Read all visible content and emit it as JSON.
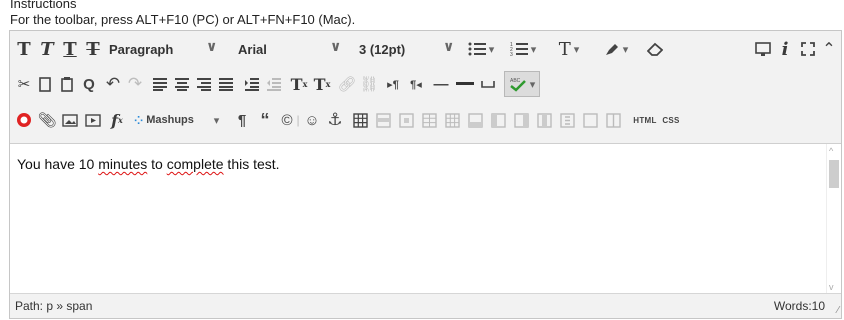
{
  "header": {
    "title": "Instructions",
    "hint": "For the toolbar, press ALT+F10 (PC) or ALT+FN+F10 (Mac)."
  },
  "toolbar": {
    "format_select": "Paragraph",
    "font_select": "Arial",
    "size_select": "3 (12pt)",
    "mashups_label": "Mashups",
    "html_label": "HTML",
    "css_label": "CSS"
  },
  "editor": {
    "before": "You have 10 ",
    "word1": "minutes",
    "middle": " to ",
    "word2": "complete",
    "after": " this test."
  },
  "status": {
    "path": "Path: p » span",
    "words": "Words:10"
  },
  "icons": [
    "bold-icon",
    "italic-icon",
    "underline-icon",
    "strikethrough-icon",
    "bullet-list-icon",
    "numbered-list-icon",
    "text-color-icon",
    "highlight-icon",
    "clear-format-icon",
    "preview-icon",
    "info-icon",
    "fullscreen-icon",
    "collapse-icon",
    "cut-icon",
    "copy-icon",
    "paste-icon",
    "find-icon",
    "undo-icon",
    "redo-icon",
    "align-left-icon",
    "align-center-icon",
    "align-right-icon",
    "justify-icon",
    "indent-icon",
    "outdent-icon",
    "superscript-icon",
    "subscript-icon",
    "link-icon",
    "unlink-icon",
    "ltr-icon",
    "rtl-icon",
    "hr-icon",
    "spellcheck-icon",
    "youtube-icon",
    "attach-icon",
    "image-icon",
    "media-icon",
    "formula-icon",
    "pilcrow-icon",
    "quote-icon",
    "copyright-icon",
    "emoji-icon",
    "anchor-icon",
    "table-icon"
  ]
}
